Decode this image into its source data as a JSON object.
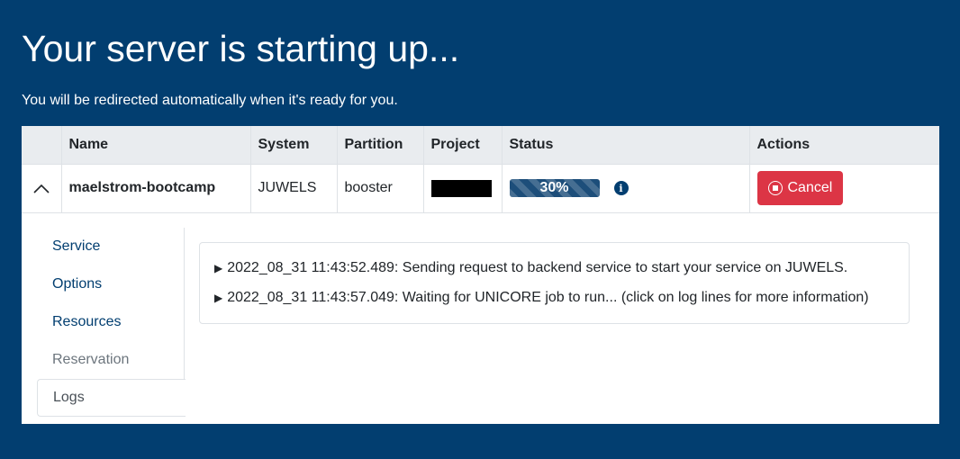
{
  "page": {
    "title": "Your server is starting up...",
    "subtitle": "You will be redirected automatically when it's ready for you."
  },
  "table": {
    "headers": {
      "name": "Name",
      "system": "System",
      "partition": "Partition",
      "project": "Project",
      "status": "Status",
      "actions": "Actions"
    },
    "row": {
      "name": "maelstrom-bootcamp",
      "system": "JUWELS",
      "partition": "booster",
      "project": "",
      "progress_percent": 30,
      "progress_label": "30%",
      "cancel_label": "Cancel"
    }
  },
  "nav": {
    "items": [
      {
        "label": "Service",
        "state": "enabled"
      },
      {
        "label": "Options",
        "state": "enabled"
      },
      {
        "label": "Resources",
        "state": "enabled"
      },
      {
        "label": "Reservation",
        "state": "disabled"
      },
      {
        "label": "Logs",
        "state": "active"
      }
    ]
  },
  "logs": [
    "2022_08_31 11:43:52.489: Sending request to backend service to start your service on JUWELS.",
    "2022_08_31 11:43:57.049: Waiting for UNICORE job to run... (click on log lines for more information)"
  ],
  "icons": {
    "collapse": "chevron-up-icon",
    "info": "info-icon",
    "stop": "stop-circle-icon",
    "log_toggle": "caret-right-icon"
  },
  "colors": {
    "background": "#023e70",
    "progress": "#1d4e7a",
    "danger": "#dc3545",
    "link": "#023e70"
  }
}
